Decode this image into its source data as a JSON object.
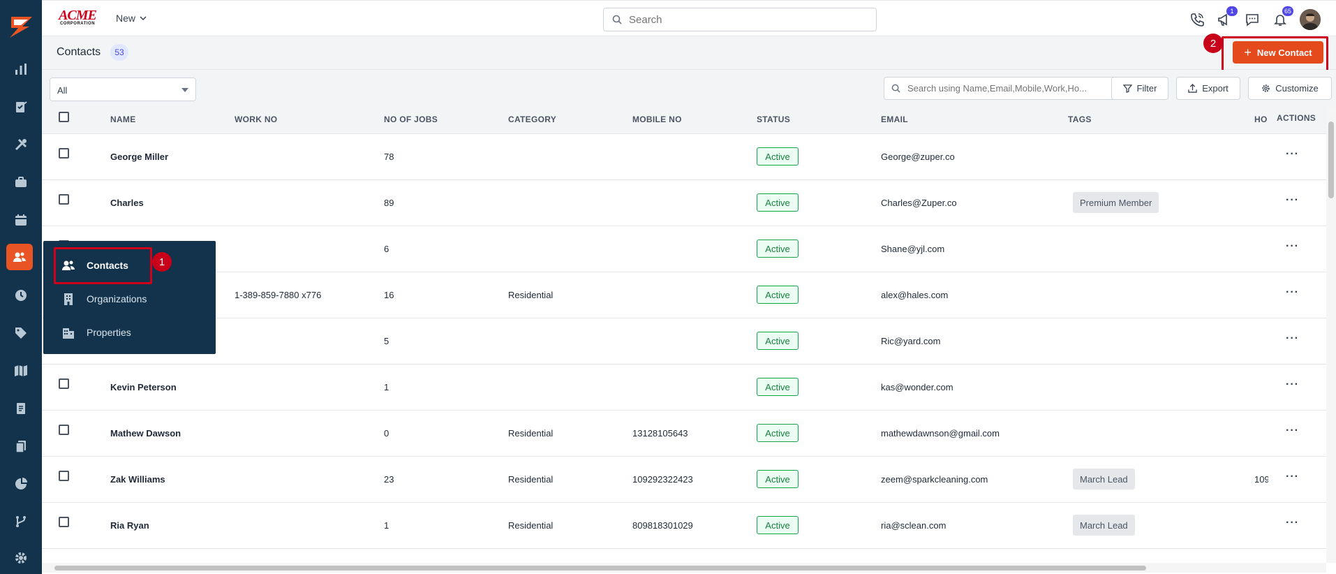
{
  "brand": {
    "line1": "ACME",
    "line2": "CORPORATION"
  },
  "topbar": {
    "new_label": "New",
    "search_placeholder": "Search",
    "campaign_badge": "1",
    "notification_badge": "65"
  },
  "page": {
    "title": "Contacts",
    "count": "53",
    "new_button": "New Contact",
    "step1": "1",
    "step2": "2"
  },
  "filters": {
    "view_select": "All",
    "table_search_placeholder": "Search using Name,Email,Mobile,Work,Ho...",
    "filter_label": "Filter",
    "export_label": "Export",
    "customize_label": "Customize"
  },
  "columns": {
    "name": "NAME",
    "work_no": "WORK NO",
    "no_of_jobs": "NO OF JOBS",
    "category": "CATEGORY",
    "mobile_no": "MOBILE NO",
    "status": "STATUS",
    "email": "EMAIL",
    "tags": "TAGS",
    "home_no": "HO",
    "actions": "ACTIONS"
  },
  "rows": [
    {
      "name": "George Miller",
      "work_no": "",
      "jobs": "78",
      "category": "",
      "mobile": "",
      "status": "Active",
      "email": "George@zuper.co",
      "tag": "",
      "home": ""
    },
    {
      "name": "Charles",
      "work_no": "",
      "jobs": "89",
      "category": "",
      "mobile": "",
      "status": "Active",
      "email": "Charles@Zuper.co",
      "tag": "Premium Member",
      "home": ""
    },
    {
      "name": "",
      "work_no": "",
      "jobs": "6",
      "category": "",
      "mobile": "",
      "status": "Active",
      "email": "Shane@yjl.com",
      "tag": "",
      "home": ""
    },
    {
      "name": "",
      "work_no": "1-389-859-7880 x776",
      "jobs": "16",
      "category": "Residential",
      "mobile": "",
      "status": "Active",
      "email": "alex@hales.com",
      "tag": "",
      "home": ""
    },
    {
      "name": "",
      "work_no": "",
      "jobs": "5",
      "category": "",
      "mobile": "",
      "status": "Active",
      "email": "Ric@yard.com",
      "tag": "",
      "home": ""
    },
    {
      "name": "Kevin Peterson",
      "work_no": "",
      "jobs": "1",
      "category": "",
      "mobile": "",
      "status": "Active",
      "email": "kas@wonder.com",
      "tag": "",
      "home": ""
    },
    {
      "name": "Mathew Dawson",
      "work_no": "",
      "jobs": "0",
      "category": "Residential",
      "mobile": "13128105643",
      "status": "Active",
      "email": "mathewdawnson@gmail.com",
      "tag": "",
      "home": ""
    },
    {
      "name": "Zak Williams",
      "work_no": "",
      "jobs": "23",
      "category": "Residential",
      "mobile": "109292322423",
      "status": "Active",
      "email": "zeem@sparkcleaning.com",
      "tag": "March Lead",
      "home": "109"
    },
    {
      "name": "Ria Ryan",
      "work_no": "",
      "jobs": "1",
      "category": "Residential",
      "mobile": "809818301029",
      "status": "Active",
      "email": "ria@sclean.com",
      "tag": "March Lead",
      "home": ""
    }
  ],
  "actions_glyph": "···",
  "flyout": {
    "items": [
      {
        "label": "Contacts"
      },
      {
        "label": "Organizations"
      },
      {
        "label": "Properties"
      }
    ]
  },
  "colors": {
    "rail": "#12334b",
    "accent": "#e44a1c",
    "highlight": "#d0021b",
    "active_status": "#16a34a"
  }
}
